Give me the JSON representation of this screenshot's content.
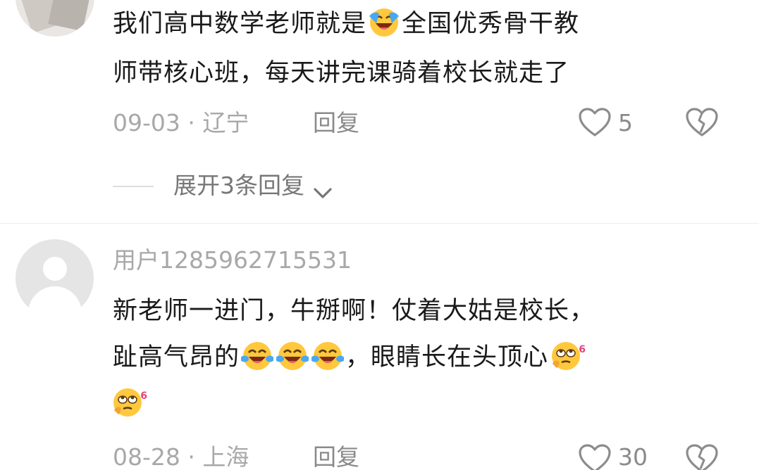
{
  "comments": [
    {
      "text_line1_part1": "我们高中数学老师就是",
      "text_line1_part2": "全国优秀骨干教",
      "text_line2": "师带核心班，每天讲完课骑着校长就走了",
      "date": "09-03",
      "separator": "·",
      "location": "辽宁",
      "reply_label": "回复",
      "like_count": "5",
      "expand_replies_label": "展开3条回复"
    },
    {
      "username": "用户1285962715531",
      "text_line1": "新老师一进门，牛掰啊！仗着大姑是校长，",
      "text_line2_part1": "趾高气昂的",
      "text_line2_part2": "，眼睛长在头顶心",
      "emoji_badge": "6",
      "date": "08-28",
      "separator": "·",
      "location": "上海",
      "reply_label": "回复",
      "like_count": "30"
    }
  ],
  "icons": {
    "laugh_emoji": "tears-of-joy-emoji",
    "rolling_eyes_emoji": "rolling-eyes-emoji",
    "like": "heart-outline-icon",
    "dislike": "broken-heart-icon",
    "expand": "chevron-down-icon"
  },
  "colors": {
    "text": "#1a1a1a",
    "meta": "#a8a8a8",
    "emoji_yellow": "#ffc83d"
  }
}
